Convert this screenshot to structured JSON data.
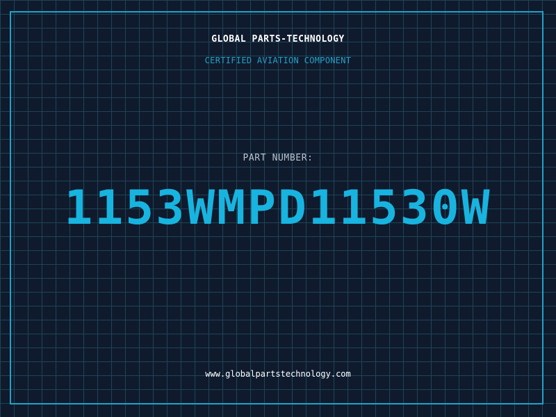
{
  "brand": {
    "name": "GLOBAL PARTS-TECHNOLOGY",
    "tagline": "CERTIFIED AVIATION COMPONENT"
  },
  "part": {
    "label": "PART NUMBER:",
    "number": "1153WMPD11530W"
  },
  "footer": {
    "website": "www.globalpartstechnology.com"
  },
  "colors": {
    "background": "#101a2d",
    "grid": "#1c4657",
    "accent": "#1fa3c9",
    "part_number": "#18b4e0"
  }
}
